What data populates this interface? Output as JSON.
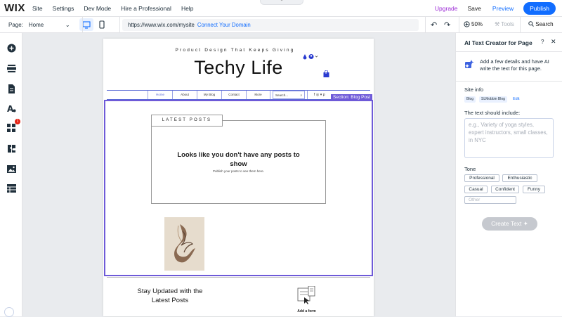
{
  "topbar": {
    "logo": "WIX",
    "menu": [
      "Site",
      "Settings",
      "Dev Mode",
      "Hire a Professional",
      "Help"
    ],
    "upgrade": "Upgrade",
    "save": "Save",
    "preview": "Preview",
    "publish": "Publish"
  },
  "secondary": {
    "page_label": "Page:",
    "page_name": "Home",
    "url": "https://www.wix.com/mysite",
    "connect": "Connect Your Domain",
    "zoom": "50%",
    "tools": "Tools",
    "search": "Search"
  },
  "site": {
    "tagline": "Product Design That Keeps Giving",
    "title": "Techy Life",
    "cart_count": "0",
    "nav": [
      "Home",
      "About",
      "My Blog",
      "Contact",
      "More"
    ],
    "nav_search": "Search...",
    "section_label": "Section: Blog Post",
    "latest_posts": "LATEST POSTS",
    "no_posts": "Looks like you don't have any posts to show",
    "publish_hint": "Publish your posts to see them here.",
    "stay_updated": "Stay Updated with the Latest Posts",
    "add_form": "Add a form"
  },
  "panel": {
    "title": "AI Text Creator for Page",
    "help": "?",
    "intro": "Add a few details and have AI write the text for this page.",
    "site_info_label": "Site info",
    "chips": [
      "Blog",
      "SLMobbin Blog"
    ],
    "edit": "Edit",
    "include_label": "The text should include:",
    "include_placeholder": "e.g., Variety of yoga styles, expert instructors, small classes, in NYC",
    "tone_label": "Tone",
    "tones": [
      "Professional",
      "Enthusiastic",
      "Casual",
      "Confident",
      "Funny"
    ],
    "other_placeholder": "Other",
    "create_button": "Create Text"
  },
  "colors": {
    "accent": "#116dff",
    "upgrade": "#9a27d5",
    "selection": "#6e5ad8",
    "badge": "#e62214"
  }
}
